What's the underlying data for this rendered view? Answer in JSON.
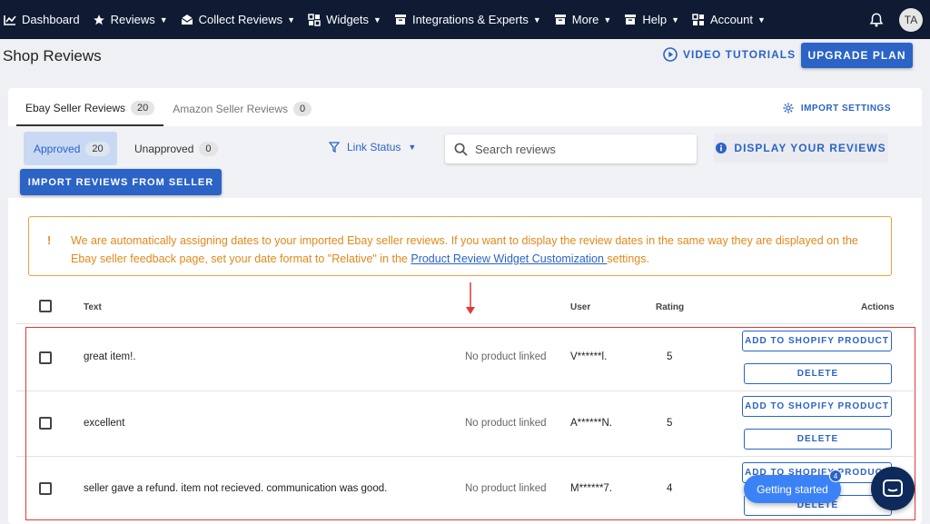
{
  "nav": {
    "items": [
      {
        "label": "Dashboard",
        "icon": "chart-icon",
        "dropdown": false
      },
      {
        "label": "Reviews",
        "icon": "star-icon",
        "dropdown": true
      },
      {
        "label": "Collect Reviews",
        "icon": "mail-icon",
        "dropdown": true
      },
      {
        "label": "Widgets",
        "icon": "widgets-icon",
        "dropdown": true
      },
      {
        "label": "Integrations & Experts",
        "icon": "box-icon",
        "dropdown": true
      },
      {
        "label": "More",
        "icon": "archive-icon",
        "dropdown": true
      },
      {
        "label": "Help",
        "icon": "help-icon",
        "dropdown": true
      },
      {
        "label": "Account",
        "icon": "grid-icon",
        "dropdown": true
      }
    ],
    "avatar": "TA"
  },
  "header": {
    "title": "Shop Reviews",
    "video_label": "VIDEO TUTORIALS",
    "upgrade_label": "UPGRADE PLAN"
  },
  "tabs": [
    {
      "label": "Ebay Seller Reviews",
      "count": "20",
      "active": true
    },
    {
      "label": "Amazon Seller Reviews",
      "count": "0",
      "active": false
    }
  ],
  "import_settings_label": "IMPORT SETTINGS",
  "filters": {
    "approved_label": "Approved",
    "approved_count": "20",
    "unapproved_label": "Unapproved",
    "unapproved_count": "0",
    "link_status_label": "Link Status",
    "search_placeholder": "Search reviews",
    "display_label": "DISPLAY YOUR REVIEWS",
    "import_seller_label": "IMPORT REVIEWS FROM SELLER"
  },
  "notice": {
    "bang": "!",
    "text_before": "We are automatically assigning dates to your imported Ebay seller reviews. If you want to display the review dates in the same way they are displayed on the Ebay seller feedback page, set your date format to \"Relative\" in the ",
    "link": "Product Review Widget Customization ",
    "text_after": "settings."
  },
  "table": {
    "headers": {
      "text": "Text",
      "user": "User",
      "rating": "Rating",
      "actions": "Actions"
    },
    "rows": [
      {
        "text": "great item!.",
        "product": "No product linked",
        "user": "V******l.",
        "rating": "5",
        "add_label": "ADD TO SHOPIFY PRODUCT",
        "delete_label": "DELETE"
      },
      {
        "text": "excellent",
        "product": "No product linked",
        "user": "A******N.",
        "rating": "5",
        "add_label": "ADD TO SHOPIFY PRODUCT",
        "delete_label": "DELETE"
      },
      {
        "text": "seller gave a refund. item not recieved. communication was good.",
        "product": "No product linked",
        "user": "M******7.",
        "rating": "4",
        "add_label": "ADD TO SHOPIFY PRODUCT",
        "delete_label": "DELETE"
      }
    ]
  },
  "widget": {
    "getting_started_label": "Getting started",
    "getting_started_count": "4"
  },
  "colors": {
    "nav_bg": "#0e1b33",
    "accent": "#2b63c6",
    "notice": "#e0891b",
    "annotation": "#e53935"
  }
}
